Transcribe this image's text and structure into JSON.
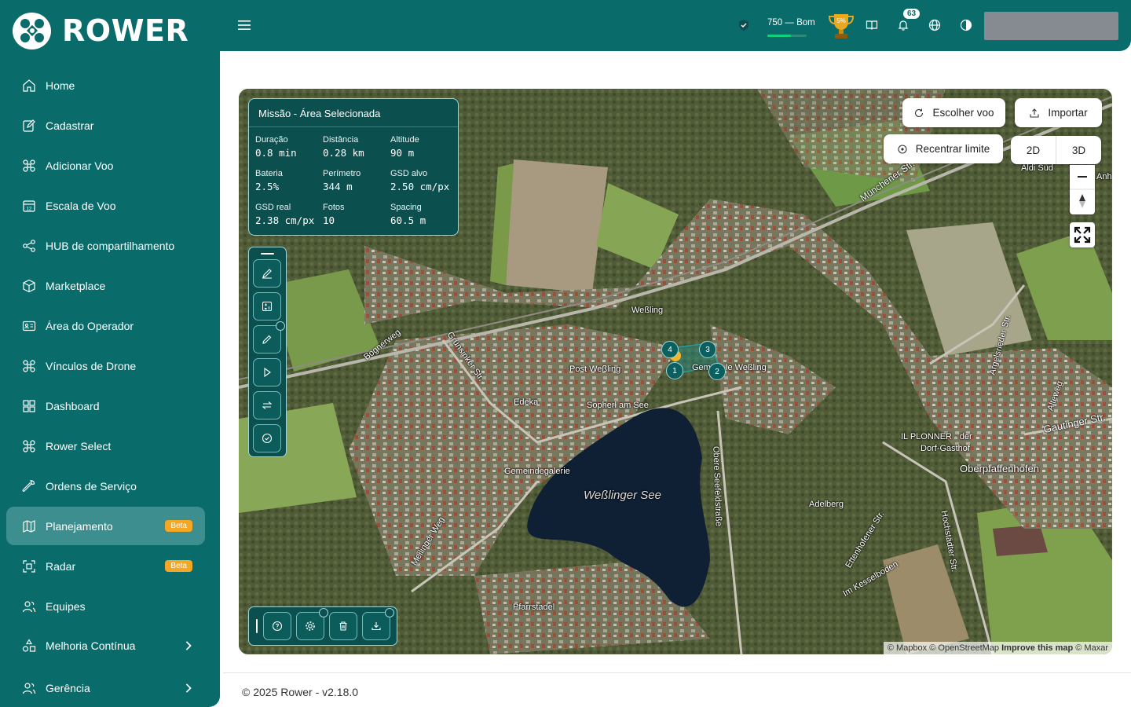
{
  "brand": {
    "name": "ROWER",
    "logo_icon": "drone-logo-icon"
  },
  "sidebar": {
    "items": [
      {
        "label": "Home",
        "icon": "home-icon"
      },
      {
        "label": "Cadastrar",
        "icon": "edit-icon"
      },
      {
        "label": "Adicionar Voo",
        "icon": "drone-icon"
      },
      {
        "label": "Escala de Voo",
        "icon": "calendar-icon"
      },
      {
        "label": "HUB de compartilhamento",
        "icon": "share-icon"
      },
      {
        "label": "Marketplace",
        "icon": "box-icon"
      },
      {
        "label": "Área do Operador",
        "icon": "id-card-icon"
      },
      {
        "label": "Vínculos de Drone",
        "icon": "drone-icon"
      },
      {
        "label": "Dashboard",
        "icon": "grid-icon"
      },
      {
        "label": "Rower Select",
        "icon": "drone-icon"
      },
      {
        "label": "Ordens de Serviço",
        "icon": "wrench-icon"
      },
      {
        "label": "Planejamento",
        "icon": "map-icon",
        "badge": "Beta",
        "active": true
      },
      {
        "label": "Radar",
        "icon": "scan-icon",
        "badge": "Beta"
      },
      {
        "label": "Equipes",
        "icon": "users-icon"
      },
      {
        "label": "Melhoria Contínua",
        "icon": "shapes-icon",
        "expandable": true
      },
      {
        "label": "Gerência",
        "icon": "users-icon",
        "expandable": true
      }
    ]
  },
  "topbar": {
    "score_text": "750 — Bom",
    "score_progress": 0.6,
    "trophy_text": "5%",
    "notifications_count": "63"
  },
  "mission": {
    "title": "Missão - Área Selecionada",
    "stats": [
      {
        "label": "Duração",
        "value": "0.8 min"
      },
      {
        "label": "Distância",
        "value": "0.28 km"
      },
      {
        "label": "Altitude",
        "value": "90 m"
      },
      {
        "label": "Bateria",
        "value": "2.5%"
      },
      {
        "label": "Perímetro",
        "value": "344 m"
      },
      {
        "label": "GSD alvo",
        "value": "2.50 cm/px"
      },
      {
        "label": "GSD real",
        "value": "2.38 cm/px"
      },
      {
        "label": "Fotos",
        "value": "10"
      },
      {
        "label": "Spacing",
        "value": "60.5 m"
      }
    ]
  },
  "map_controls": {
    "choose_flight": "Escolher voo",
    "import": "Importar",
    "recenter": "Recentrar limite",
    "mode_2d": "2D",
    "mode_3d": "3D"
  },
  "map": {
    "labels": {
      "wessling": "Weßling",
      "post": "Post Weßling",
      "gem": "Gem",
      "gem2": "le Weßling",
      "edeka": "Edeka",
      "sopherl": "Sopherl am See",
      "gemeinde": "Gemeindegalerie",
      "lake": "Weßlinger See",
      "pfarr": "Pfarrstadel",
      "adelberg": "Adelberg",
      "oberpf": "Oberpfaffenhofen",
      "planner1": "IL PLONNER - der",
      "planner2": "Dorf-Gasthof",
      "gautinger": "Gautinger Str.",
      "munchener": "Münchener Str.",
      "bognerweg": "Bognerweg",
      "grunsinker": "Grünsinker Str.",
      "meilinger": "Meilinger Weg",
      "obere": "Obere Seefeldstraße",
      "ettenhofener": "Ettenhofener Str.",
      "hochstadter": "Hochstädter Str.",
      "kessel": "Im Kesselboden",
      "argelsrieder": "Argelsrieder Str.",
      "alte": "Alteweg",
      "aldi": "Aldi Süd",
      "anh": "Anh"
    },
    "waypoints": [
      "1",
      "2",
      "3",
      "4"
    ],
    "attribution": {
      "mapbox": "© Mapbox",
      "osm": "© OpenStreetMap",
      "improve": "Improve this map",
      "maxar": "© Maxar"
    }
  },
  "footer": {
    "text": "© 2025 Rower - v2.18.0"
  },
  "colors": {
    "primary": "#0a6b6b",
    "panel": "#0b4f4f",
    "accent": "#f5a623"
  }
}
